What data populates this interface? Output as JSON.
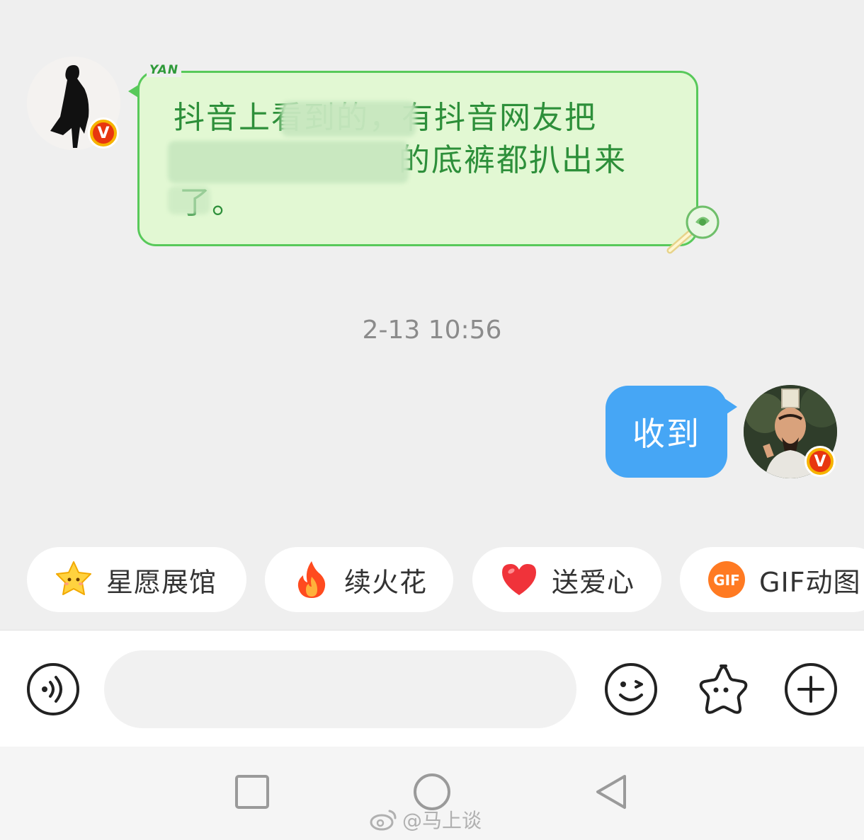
{
  "incoming": {
    "tag": "YAN",
    "line1": "抖音上看到的，有抖音网友把",
    "line2": "的底裤都扒出来",
    "line3": "了。"
  },
  "timestamp": "2-13 10:56",
  "outgoing": {
    "text": "收到"
  },
  "badge": "V",
  "chips": [
    {
      "label": "星愿展馆",
      "icon": "star-face-icon"
    },
    {
      "label": "续火花",
      "icon": "fire-icon"
    },
    {
      "label": "送爱心",
      "icon": "heart-icon"
    },
    {
      "label": "GIF动图",
      "icon": "gif-icon",
      "icon_text": "GIF"
    }
  ],
  "input": {
    "value": "",
    "placeholder": ""
  },
  "watermark": "@马上谈",
  "colors": {
    "incoming_bubble": "#e2f8d3",
    "incoming_border": "#58c95a",
    "incoming_text": "#2d8f3a",
    "outgoing_bubble": "#46a6f5"
  }
}
